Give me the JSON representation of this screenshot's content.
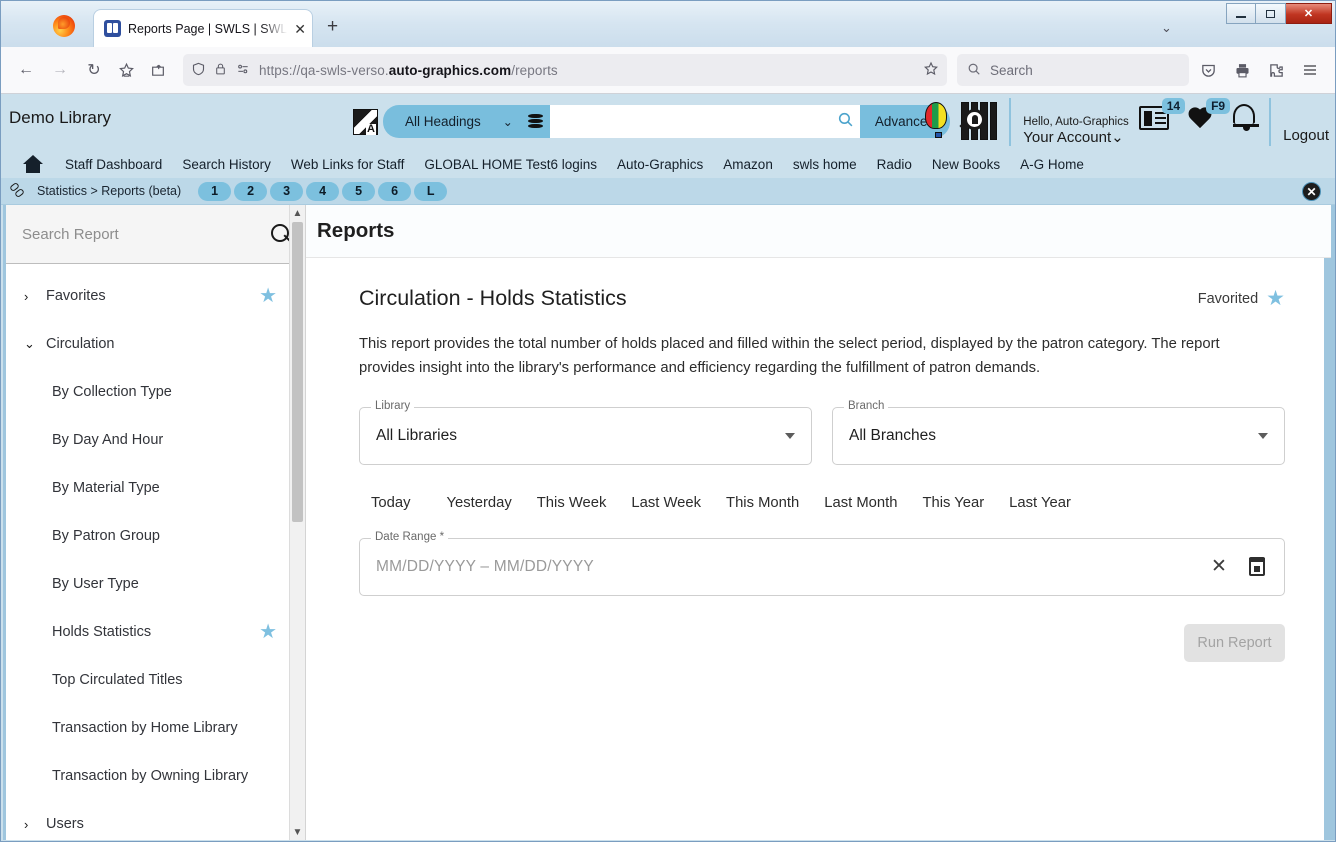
{
  "browser": {
    "tab": {
      "title": "Reports Page | SWLS | SWLS | Au",
      "close_label": "✕",
      "favicon": "sw-favicon-icon"
    },
    "newtab_label": "+",
    "tabs_chevron": "⌄",
    "window_controls": {
      "minimize": "minimize-icon",
      "maximize": "maximize-icon",
      "close": "✕"
    },
    "nav": {
      "back": "←",
      "forward": "→",
      "reload": "↻"
    },
    "url": {
      "prefix": "https://qa-swls-verso.",
      "domain": "auto-graphics.com",
      "suffix": "/reports"
    },
    "search_placeholder": "Search",
    "toolbar_icons": [
      "bookmark-star-icon",
      "save-to-pocket-icon",
      "shield-icon",
      "lock-icon",
      "permissions-icon",
      "pocket-icon",
      "print-icon",
      "extensions-icon",
      "app-menu-icon"
    ]
  },
  "app_header": {
    "library_name": "Demo Library",
    "search_scope": "All Headings",
    "search_value": "",
    "advanced_label": "Advanced",
    "account_greeting": "Hello, Auto-Graphics",
    "account_label": "Your Account",
    "account_caret": "⌄",
    "logout_label": "Logout",
    "badge_count": "14",
    "badge_key": "F9"
  },
  "navlinks": [
    "Staff Dashboard",
    "Search History",
    "Web Links for Staff",
    "GLOBAL HOME Test6 logins",
    "Auto-Graphics",
    "Amazon",
    "swls home",
    "Radio",
    "New Books",
    "A-G Home"
  ],
  "breadcrumb": {
    "text": "Statistics > Reports (beta)",
    "pills": [
      "1",
      "2",
      "3",
      "4",
      "5",
      "6",
      "L"
    ],
    "close_label": "✕"
  },
  "sidebar": {
    "search_placeholder": "Search Report",
    "search_value": "",
    "items": [
      {
        "label": "Favorites",
        "chevron": "›",
        "level": "top",
        "starred": true
      },
      {
        "label": "Circulation",
        "chevron": "⌄",
        "level": "top",
        "starred": false
      },
      {
        "label": "By Collection Type",
        "level": "child",
        "starred": false
      },
      {
        "label": "By Day And Hour",
        "level": "child",
        "starred": false
      },
      {
        "label": "By Material Type",
        "level": "child",
        "starred": false
      },
      {
        "label": "By Patron Group",
        "level": "child",
        "starred": false
      },
      {
        "label": "By User Type",
        "level": "child",
        "starred": false
      },
      {
        "label": "Holds Statistics",
        "level": "child",
        "starred": true
      },
      {
        "label": "Top Circulated Titles",
        "level": "child",
        "starred": false
      },
      {
        "label": "Transaction by Home Library",
        "level": "child",
        "starred": false
      },
      {
        "label": "Transaction by Owning Library",
        "level": "child",
        "starred": false
      },
      {
        "label": "Users",
        "chevron": "›",
        "level": "top",
        "starred": false
      }
    ]
  },
  "main": {
    "page_title": "Reports",
    "report_title": "Circulation - Holds Statistics",
    "favorited_label": "Favorited",
    "description": "This report provides the total number of holds placed and filled within the select period, displayed by the patron category. The report provides insight into the library's performance and efficiency regarding the fulfillment of patron demands.",
    "library_field": {
      "label": "Library",
      "value": "All Libraries"
    },
    "branch_field": {
      "label": "Branch",
      "value": "All Branches"
    },
    "period_tabs": [
      "Today",
      "Yesterday",
      "This Week",
      "Last Week",
      "This Month",
      "Last Month",
      "This Year",
      "Last Year"
    ],
    "date_range": {
      "label": "Date Range *",
      "placeholder": "MM/DD/YYYY – MM/DD/YYYY",
      "value": ""
    },
    "run_button": "Run Report"
  },
  "colors": {
    "app_header_bg": "#cbe0ec",
    "accent": "#79bedd",
    "star": "#7fc0e0",
    "breadcrumb_bg": "#bcd8e8"
  }
}
